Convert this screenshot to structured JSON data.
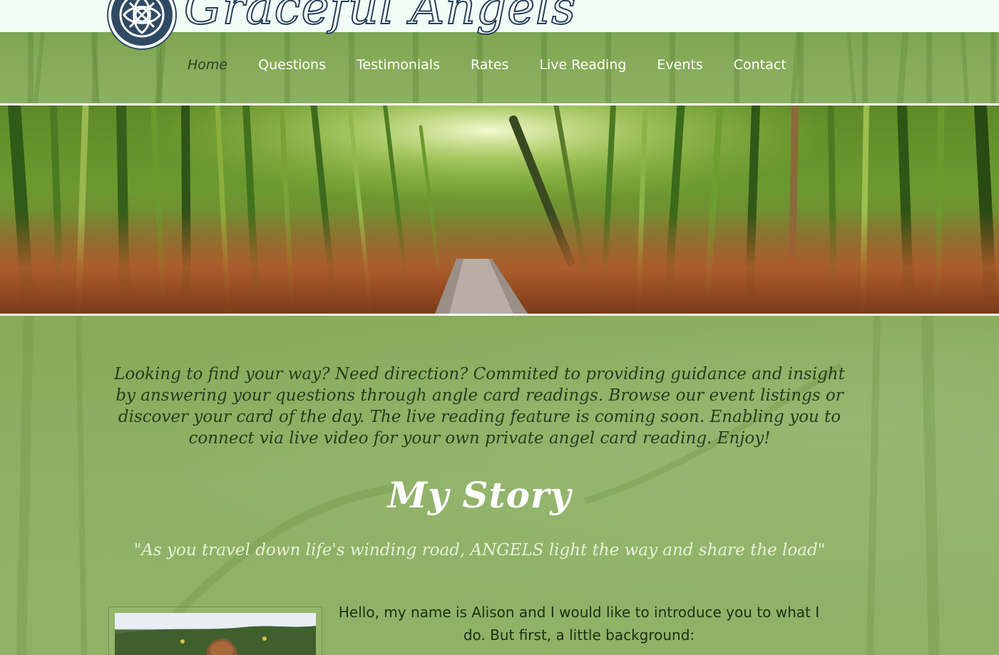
{
  "site": {
    "logo_text": "Graceful Angels"
  },
  "nav": {
    "items": [
      {
        "label": "Home",
        "active": true
      },
      {
        "label": "Questions",
        "active": false
      },
      {
        "label": "Testimonials",
        "active": false
      },
      {
        "label": "Rates",
        "active": false
      },
      {
        "label": "Live Reading",
        "active": false
      },
      {
        "label": "Events",
        "active": false
      },
      {
        "label": "Contact",
        "active": false
      }
    ]
  },
  "main": {
    "intro": "Looking to find your way? Need direction? Commited to providing guidance and insight by answering your questions through angle card readings. Browse our event listings or discover your card of the day. The live reading feature is coming soon. Enabling you to connect via live video for your own private angel card reading. Enjoy!",
    "story_title": "My Story",
    "quote": "\"As you travel down life's winding road, ANGELS light the way and share the load\"",
    "hello_text": "Hello, my name is Alison and I would like to introduce you to what I do. But first, a little background:"
  },
  "colors": {
    "header_bg": "#f2fcf6",
    "nav_band": "#86aa58",
    "active_nav": "#2c4222",
    "logo_navy": "#2f4a63"
  }
}
